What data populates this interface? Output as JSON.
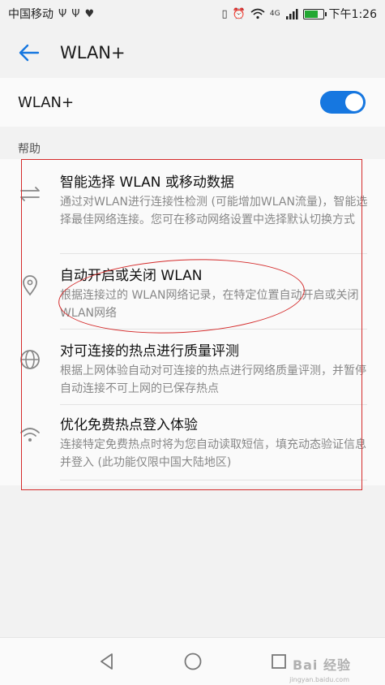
{
  "status_bar": {
    "carrier": "中国移动",
    "left_icons": [
      "usb-icon",
      "usb-icon",
      "heart-icon"
    ],
    "right_icons": [
      "vibrate-icon",
      "alarm-icon",
      "wifi-icon",
      "signal-icon",
      "battery-icon"
    ],
    "network_type": "4G",
    "time": "下午1:26",
    "battery_color": "#22a832"
  },
  "header": {
    "back_icon": "back-arrow-icon",
    "title": "WLAN+"
  },
  "wlan_plus": {
    "label": "WLAN+",
    "enabled": true,
    "accent": "#1677e0"
  },
  "section": {
    "title": "帮助"
  },
  "help_items": [
    {
      "icon": "swap-arrows-icon",
      "title": "智能选择 WLAN 或移动数据",
      "desc": "通过对WLAN进行连接性检测 (可能增加WLAN流量)，智能选择最佳网络连接。您可在移动网络设置中选择默认切换方式"
    },
    {
      "icon": "location-pin-icon",
      "title": "自动开启或关闭 WLAN",
      "desc": "根据连接过的 WLAN网络记录，在特定位置自动开启或关闭WLAN网络"
    },
    {
      "icon": "globe-icon",
      "title": "对可连接的热点进行质量评测",
      "desc": "根据上网体验自动对可连接的热点进行网络质量评测，并暂停自动连接不可上网的已保存热点"
    },
    {
      "icon": "wifi-icon",
      "title": "优化免费热点登入体验",
      "desc": "连接特定免费热点时将为您自动读取短信，填充动态验证信息并登入 (此功能仅限中国大陆地区)"
    }
  ],
  "nav_bar": {
    "buttons": [
      "back-triangle-icon",
      "home-circle-icon",
      "recents-square-icon"
    ]
  },
  "watermark": {
    "text": "Bai 经验",
    "sub": "jingyan.baidu.com"
  },
  "annotation_color": "#d42b2b"
}
